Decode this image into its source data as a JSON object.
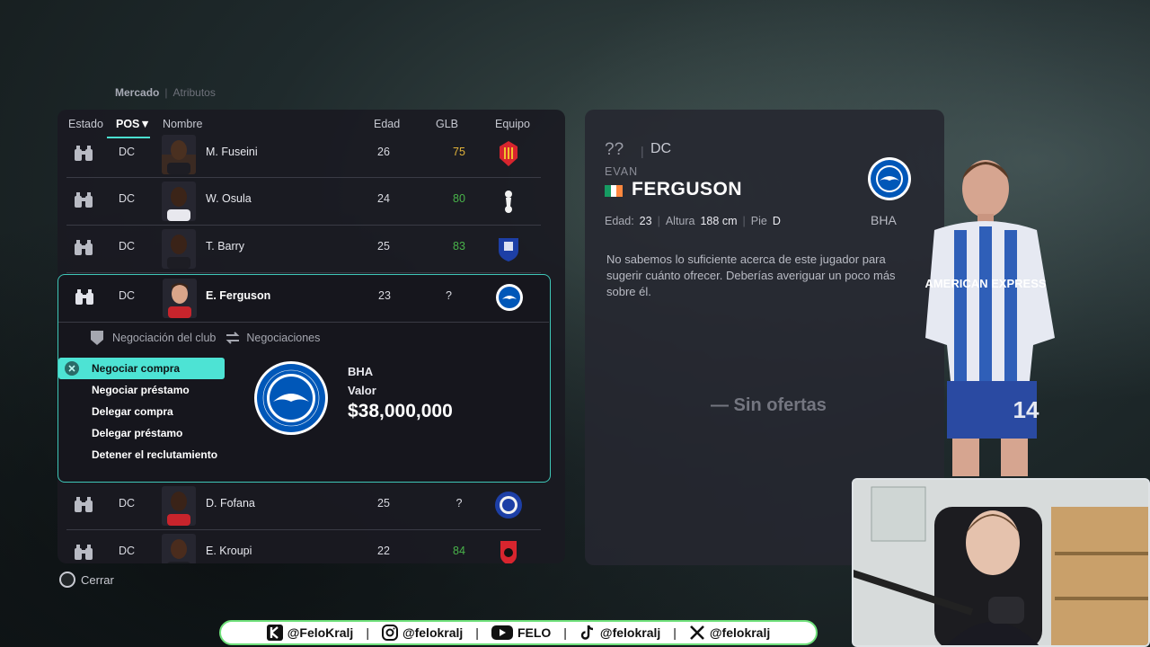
{
  "tabs": {
    "active": "Mercado",
    "inactive": "Atributos"
  },
  "columns": {
    "estado": "Estado",
    "pos": "POS",
    "nombre": "Nombre",
    "edad": "Edad",
    "glb": "GLB",
    "equipo": "Equipo"
  },
  "players": [
    {
      "pos": "DC",
      "name": "M. Fuseini",
      "age": "26",
      "ovr": "75",
      "ovr_color": "#e0b23a",
      "club_icon": "mallorca-crest-icon"
    },
    {
      "pos": "DC",
      "name": "W. Osula",
      "age": "24",
      "ovr": "80",
      "ovr_color": "#49b34a",
      "club_icon": "tottenham-crest-icon"
    },
    {
      "pos": "DC",
      "name": "T. Barry",
      "age": "25",
      "ovr": "83",
      "ovr_color": "#49b34a",
      "club_icon": "everton-crest-icon"
    },
    {
      "pos": "DC",
      "name": "E. Ferguson",
      "age": "23",
      "ovr": "?",
      "ovr_color": "#d8d9e0",
      "club_icon": "brighton-crest-icon"
    },
    {
      "pos": "DC",
      "name": "D. Fofana",
      "age": "25",
      "ovr": "?",
      "ovr_color": "#d8d9e0",
      "club_icon": "chelsea-crest-icon"
    },
    {
      "pos": "DC",
      "name": "E. Kroupi",
      "age": "22",
      "ovr": "84",
      "ovr_color": "#49b34a",
      "club_icon": "bournemouth-crest-icon"
    }
  ],
  "expanded": {
    "sub_tabs": {
      "club_negotiation": "Negociación del club",
      "negotiations": "Negociaciones"
    },
    "menu": [
      "Negociar compra",
      "Negociar préstamo",
      "Delegar compra",
      "Delegar préstamo",
      "Detener el reclutamiento"
    ],
    "club": {
      "abbr": "BHA",
      "value_label": "Valor",
      "value": "$38,000,000"
    }
  },
  "detail": {
    "ovr": "??",
    "separator": "|",
    "pos": "DC",
    "first_name": "EVAN",
    "last_name": "FERGUSON",
    "club": "BHA",
    "stats": {
      "age_label": "Edad:",
      "age": "23",
      "height_label": "Altura",
      "height": "188 cm",
      "foot_label": "Pie",
      "foot": "D"
    },
    "message": "No sabemos lo suficiente acerca de este jugador para sugerir cuánto ofrecer. Deberías averiguar un poco más sobre él.",
    "no_offers": "— Sin ofertas"
  },
  "player_render": {
    "sponsor": "AMERICAN EXPRESS",
    "number": "14"
  },
  "close": "Cerrar",
  "social": [
    {
      "icon": "kick-icon",
      "handle": "@FeloKralj"
    },
    {
      "icon": "instagram-icon",
      "handle": "@felokralj"
    },
    {
      "icon": "youtube-icon",
      "handle": "FELO"
    },
    {
      "icon": "tiktok-icon",
      "handle": "@felokralj"
    },
    {
      "icon": "x-icon",
      "handle": "@felokralj"
    }
  ],
  "colors": {
    "accent": "#4de3d4",
    "good_rating": "#49b34a",
    "mid_rating": "#e0b23a",
    "brighton_blue": "#0057b8"
  }
}
